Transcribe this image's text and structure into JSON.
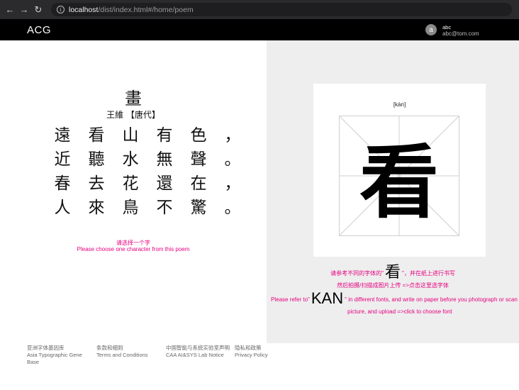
{
  "browser": {
    "url_host": "localhost",
    "url_path": "/dist/index.html#/home/poem"
  },
  "header": {
    "logo": "ACG",
    "avatar_letter": "a",
    "user_name": "abc",
    "user_email": "abc@tom.com"
  },
  "poem": {
    "title": "畫",
    "author": "王維 【唐代】",
    "lines": [
      [
        "遠",
        "看",
        "山",
        "有",
        "色",
        "，"
      ],
      [
        "近",
        "聽",
        "水",
        "無",
        "聲",
        "。"
      ],
      [
        "春",
        "去",
        "花",
        "還",
        "在",
        "，"
      ],
      [
        "人",
        "來",
        "鳥",
        "不",
        "驚",
        "。"
      ]
    ],
    "hint_zh": "请选择一个字",
    "hint_en": "Please choose one character from this poem"
  },
  "character": {
    "pinyin": "[kàn]",
    "glyph": "看",
    "refer_zh_before": "请参考不同的字体的\"",
    "refer_zh_char": "看",
    "refer_zh_after": "\"，并在纸上进行书写",
    "upload_zh": "然后拍摄/扫描成图片上传 =>点击这里选字体",
    "refer_en_before": "Please refer to\"",
    "refer_en_word": "KAN",
    "refer_en_after": "\" in different fonts, and write on paper before you photograph or scan into",
    "upload_en": "picture, and upload =>click to choose font"
  },
  "footer": {
    "links": [
      {
        "zh": "亚洲字体基因库",
        "en": "Asia Typographic Gene",
        "en2": "Base"
      },
      {
        "zh": "条款和细则",
        "en": "Terms and Conditions",
        "en2": ""
      },
      {
        "zh": "中国智能与系统实验室声明",
        "en": "CAA AI&SYS Lab Notice",
        "en2": ""
      },
      {
        "zh": "隐私和政策",
        "en": "Privacy Policy",
        "en2": ""
      }
    ]
  }
}
